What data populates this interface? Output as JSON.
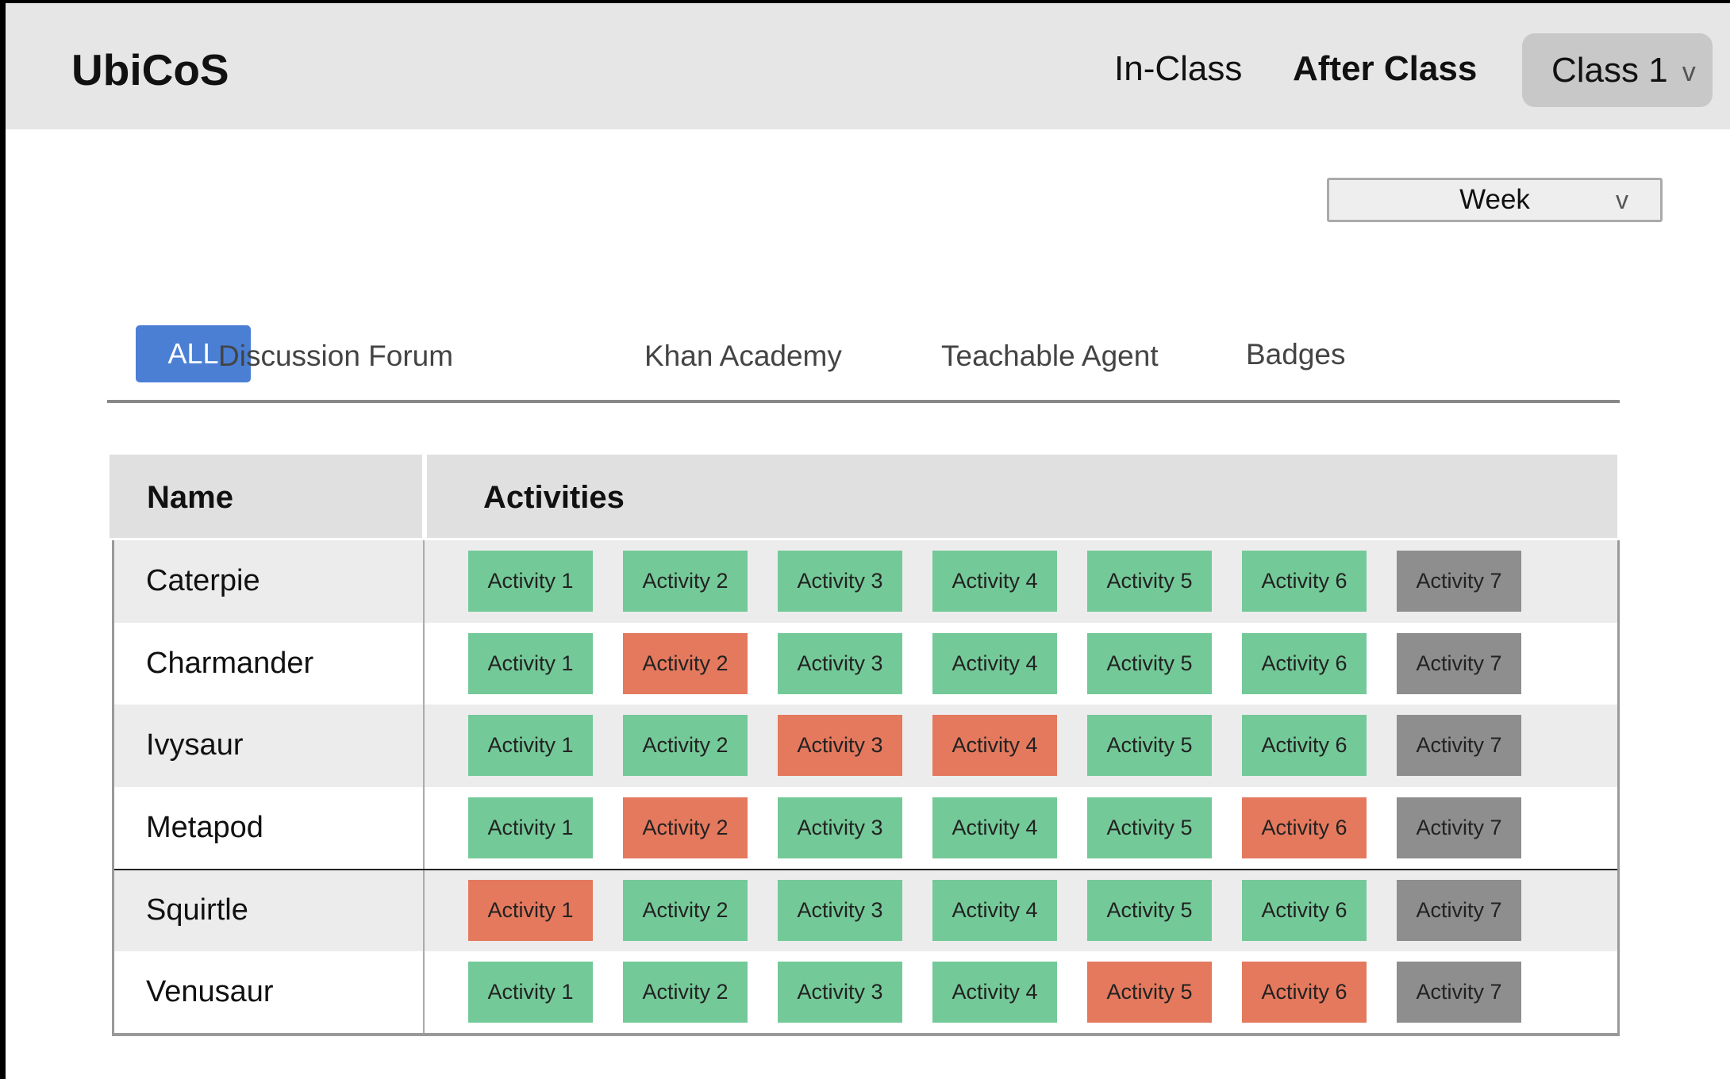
{
  "header": {
    "logo": "UbiCoS",
    "nav": [
      "In-Class",
      "After Class"
    ],
    "class_select": "Class 1",
    "chevron": "v"
  },
  "period_select": "Week",
  "tabs": [
    "ALL",
    "Discussion Forum",
    "Khan Academy",
    "Teachable Agent",
    "Badges"
  ],
  "table": {
    "headers": [
      "Name",
      "Activities"
    ],
    "status_colors": {
      "done": "#74c998",
      "missed": "#e4795e",
      "pending": "#8e8e8e"
    },
    "rows": [
      {
        "name": "Caterpie",
        "activities": [
          [
            "Activity 1",
            "done"
          ],
          [
            "Activity 2",
            "done"
          ],
          [
            "Activity 3",
            "done"
          ],
          [
            "Activity 4",
            "done"
          ],
          [
            "Activity 5",
            "done"
          ],
          [
            "Activity 6",
            "done"
          ],
          [
            "Activity 7",
            "pending"
          ]
        ]
      },
      {
        "name": "Charmander",
        "activities": [
          [
            "Activity 1",
            "done"
          ],
          [
            "Activity 2",
            "missed"
          ],
          [
            "Activity 3",
            "done"
          ],
          [
            "Activity 4",
            "done"
          ],
          [
            "Activity 5",
            "done"
          ],
          [
            "Activity 6",
            "done"
          ],
          [
            "Activity 7",
            "pending"
          ]
        ]
      },
      {
        "name": "Ivysaur",
        "activities": [
          [
            "Activity 1",
            "done"
          ],
          [
            "Activity 2",
            "done"
          ],
          [
            "Activity 3",
            "missed"
          ],
          [
            "Activity 4",
            "missed"
          ],
          [
            "Activity 5",
            "done"
          ],
          [
            "Activity 6",
            "done"
          ],
          [
            "Activity 7",
            "pending"
          ]
        ]
      },
      {
        "name": "Metapod",
        "activities": [
          [
            "Activity 1",
            "done"
          ],
          [
            "Activity 2",
            "missed"
          ],
          [
            "Activity 3",
            "done"
          ],
          [
            "Activity 4",
            "done"
          ],
          [
            "Activity 5",
            "done"
          ],
          [
            "Activity 6",
            "missed"
          ],
          [
            "Activity 7",
            "pending"
          ]
        ]
      },
      {
        "name": "Squirtle",
        "activities": [
          [
            "Activity 1",
            "missed"
          ],
          [
            "Activity 2",
            "done"
          ],
          [
            "Activity 3",
            "done"
          ],
          [
            "Activity 4",
            "done"
          ],
          [
            "Activity 5",
            "done"
          ],
          [
            "Activity 6",
            "done"
          ],
          [
            "Activity 7",
            "pending"
          ]
        ]
      },
      {
        "name": "Venusaur",
        "activities": [
          [
            "Activity 1",
            "done"
          ],
          [
            "Activity 2",
            "done"
          ],
          [
            "Activity 3",
            "done"
          ],
          [
            "Activity 4",
            "done"
          ],
          [
            "Activity 5",
            "missed"
          ],
          [
            "Activity 6",
            "missed"
          ],
          [
            "Activity 7",
            "pending"
          ]
        ]
      }
    ]
  }
}
